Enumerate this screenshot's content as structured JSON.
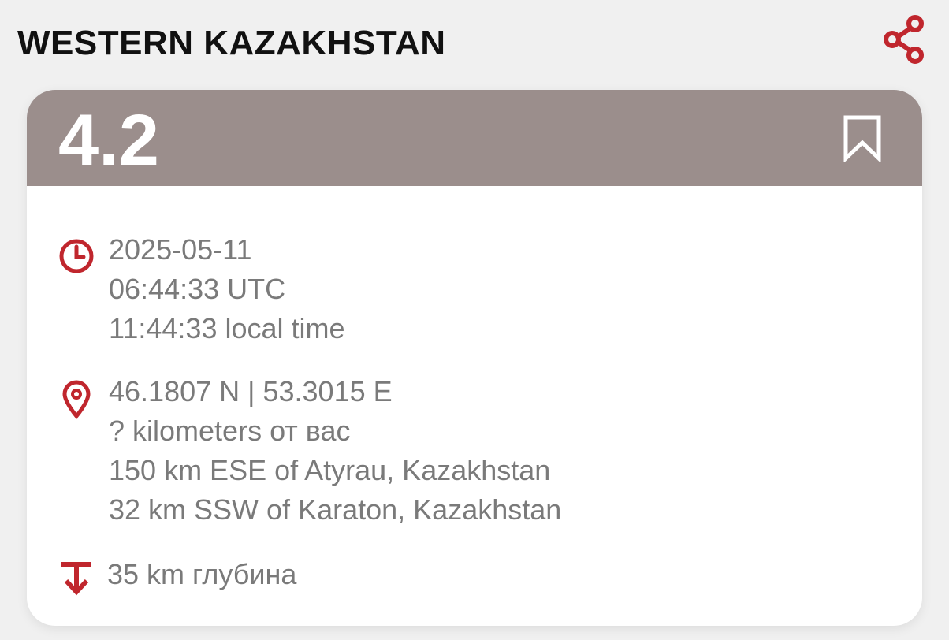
{
  "header": {
    "title": "WESTERN KAZAKHSTAN"
  },
  "icons": {
    "share": "share-icon",
    "bookmark": "bookmark-icon",
    "time": "clock-icon",
    "location": "map-pin-icon",
    "depth": "depth-arrow-icon"
  },
  "colors": {
    "accent": "#c0262d",
    "card_header": "#9b8e8c",
    "background": "#f0f0f0",
    "text_muted": "#7a7a7a"
  },
  "event": {
    "magnitude": "4.2",
    "time": {
      "date": "2025-05-11",
      "utc": "06:44:33 UTC",
      "local": "11:44:33 local time"
    },
    "location": {
      "coords": "46.1807 N | 53.3015 E",
      "distance_from_user": "? kilometers от вас",
      "nearby_1": "150 km ESE of Atyrau, Kazakhstan",
      "nearby_2": "32 km SSW of Karaton, Kazakhstan"
    },
    "depth": "35 km глубина"
  }
}
